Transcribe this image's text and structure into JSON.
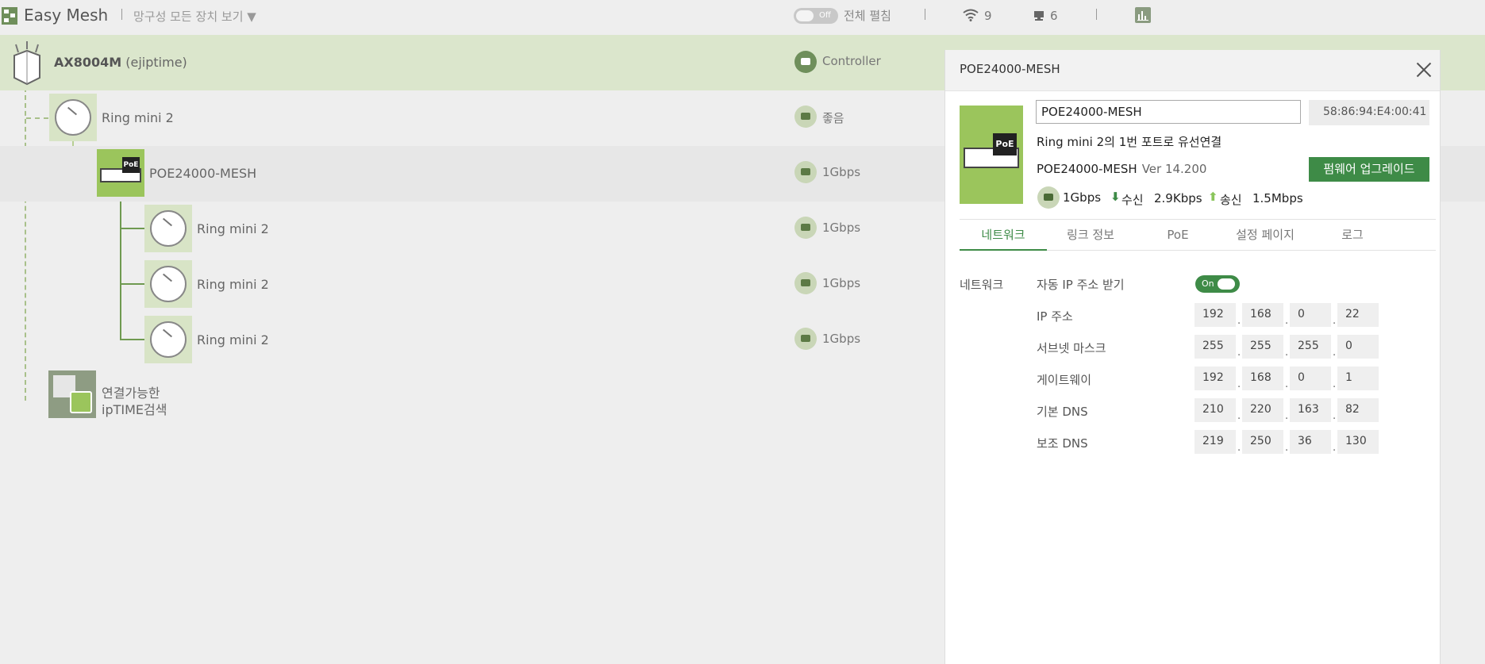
{
  "header": {
    "app_title": "Easy Mesh",
    "view_select": "망구성 모든 장치 보기 ▼",
    "expand_toggle_text": "Off",
    "expand_label": "전체 펼침",
    "wifi_count": "9",
    "client_count": "6"
  },
  "tree": {
    "controller": {
      "name": "AX8004M",
      "owner": "(ejiptime)",
      "status": "Controller"
    },
    "nodes": [
      {
        "name": "Ring mini 2",
        "status": "좋음"
      },
      {
        "name": "POE24000-MESH",
        "status": "1Gbps"
      },
      {
        "name": "Ring mini 2",
        "status": "1Gbps"
      },
      {
        "name": "Ring mini 2",
        "status": "1Gbps"
      },
      {
        "name": "Ring mini 2",
        "status": "1Gbps"
      }
    ],
    "search": {
      "line1": "연결가능한",
      "line2": "ipTIME검색"
    }
  },
  "panel": {
    "title": "POE24000-MESH",
    "device_badge": "PoE",
    "name_value": "POE24000-MESH",
    "mac": "58:86:94:E4:00:41",
    "connection_desc": "Ring mini 2의 1번 포트로 유선연결",
    "model": "POE24000-MESH",
    "version": "Ver 14.200",
    "firmware_button": "펌웨어 업그레이드",
    "speed": "1Gbps",
    "rx_label": "수신",
    "rx_value": "2.9Kbps",
    "tx_label": "송신",
    "tx_value": "1.5Mbps",
    "tabs": [
      "네트워크",
      "링크 정보",
      "PoE",
      "설정 페이지",
      "로그"
    ],
    "section_label": "네트워크",
    "dhcp_label": "자동 IP 주소 받기",
    "dhcp_toggle": "On",
    "fields": [
      {
        "label": "IP 주소",
        "octets": [
          "192",
          "168",
          "0",
          "22"
        ]
      },
      {
        "label": "서브넷 마스크",
        "octets": [
          "255",
          "255",
          "255",
          "0"
        ]
      },
      {
        "label": "게이트웨이",
        "octets": [
          "192",
          "168",
          "0",
          "1"
        ]
      },
      {
        "label": "기본 DNS",
        "octets": [
          "210",
          "220",
          "163",
          "82"
        ]
      },
      {
        "label": "보조 DNS",
        "octets": [
          "219",
          "250",
          "36",
          "130"
        ]
      }
    ]
  },
  "colors": {
    "accent": "#3e8b47",
    "light_green": "#9bc55c",
    "controller_row": "#dbe6cc"
  }
}
